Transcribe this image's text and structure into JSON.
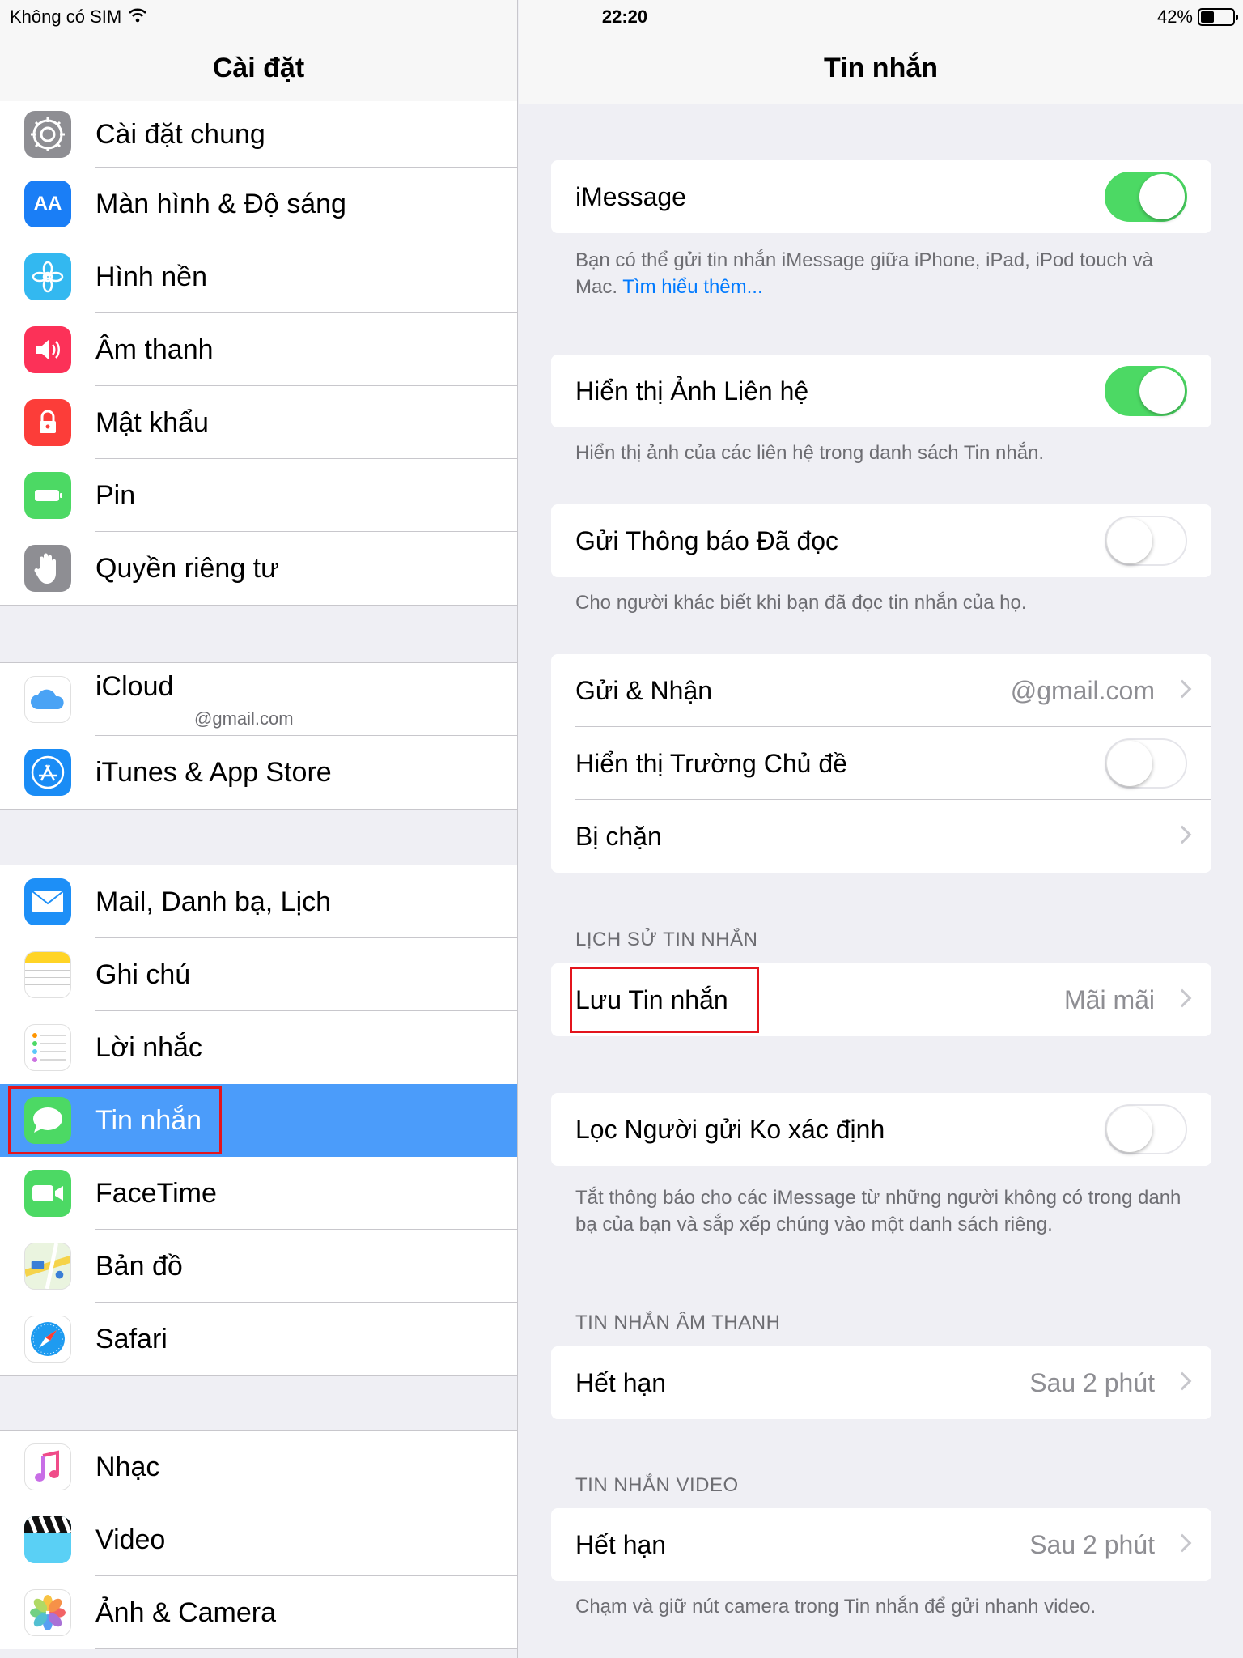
{
  "status_bar": {
    "carrier": "Không có SIM",
    "time": "22:20",
    "battery_text": "42%",
    "battery_level": 0.42
  },
  "master": {
    "title": "Cài đặt",
    "groups": [
      [
        {
          "label": "Cài đặt chung",
          "icon": "gear-icon",
          "color": "#8e8e93"
        },
        {
          "label": "Màn hình & Độ sáng",
          "icon": "display-brightness-icon",
          "color": "#1a7ef6",
          "glyph": "AA"
        },
        {
          "label": "Hình nền",
          "icon": "wallpaper-icon",
          "color": "#33b8f0"
        },
        {
          "label": "Âm thanh",
          "icon": "sound-icon",
          "color": "#fc3158"
        },
        {
          "label": "Mật khẩu",
          "icon": "lock-icon",
          "color": "#fc3d39"
        },
        {
          "label": "Pin",
          "icon": "battery-icon",
          "color": "#4cd964"
        },
        {
          "label": "Quyền riêng tư",
          "icon": "privacy-hand-icon",
          "color": "#8e8e93"
        }
      ],
      [
        {
          "label": "iCloud",
          "sub": "@gmail.com",
          "icon": "icloud-icon",
          "color": "#ffffff"
        },
        {
          "label": "iTunes & App Store",
          "icon": "app-store-icon",
          "color": "#1a8cf5"
        }
      ],
      [
        {
          "label": "Mail, Danh bạ, Lịch",
          "icon": "mail-icon",
          "color": "#1d8ff7"
        },
        {
          "label": "Ghi chú",
          "icon": "notes-icon",
          "color": "#ffffff"
        },
        {
          "label": "Lời nhắc",
          "icon": "reminders-icon",
          "color": "#ffffff"
        },
        {
          "label": "Tin nhắn",
          "icon": "messages-icon",
          "color": "#4cd964",
          "selected": true
        },
        {
          "label": "FaceTime",
          "icon": "facetime-icon",
          "color": "#4cd964"
        },
        {
          "label": "Bản đồ",
          "icon": "maps-icon",
          "color": "#ffffff"
        },
        {
          "label": "Safari",
          "icon": "safari-icon",
          "color": "#ffffff"
        }
      ],
      [
        {
          "label": "Nhạc",
          "icon": "music-icon",
          "color": "#ffffff"
        },
        {
          "label": "Video",
          "icon": "video-icon",
          "color": "#3ec6f0"
        },
        {
          "label": "Ảnh & Camera",
          "icon": "photos-icon",
          "color": "#ffffff"
        }
      ]
    ]
  },
  "detail": {
    "title": "Tin nhắn",
    "imessage": {
      "label": "iMessage",
      "on": true,
      "footer": "Bạn có thể gửi tin nhắn iMessage giữa iPhone, iPad, iPod touch và Mac.",
      "footer_link": "Tìm hiểu thêm..."
    },
    "contact_photos": {
      "label": "Hiển thị Ảnh Liên hệ",
      "on": true,
      "footer": "Hiển thị ảnh của các liên hệ trong danh sách Tin nhắn."
    },
    "read_receipts": {
      "label": "Gửi Thông báo Đã đọc",
      "on": false,
      "footer": "Cho người khác biết khi bạn đã đọc tin nhắn của họ."
    },
    "send_receive": {
      "label": "Gửi & Nhận",
      "value": "@gmail.com"
    },
    "subject_field": {
      "label": "Hiển thị Trường Chủ đề",
      "on": false
    },
    "blocked": {
      "label": "Bị chặn"
    },
    "history_header": "LỊCH SỬ TIN NHẮN",
    "keep_messages": {
      "label": "Lưu Tin nhắn",
      "value": "Mãi mãi"
    },
    "filter_unknown": {
      "label": "Lọc Người gửi Ko xác định",
      "on": false,
      "footer": "Tắt thông báo cho các iMessage từ những người không có trong danh bạ của bạn và sắp xếp chúng vào một danh sách riêng."
    },
    "audio_header": "TIN NHẮN ÂM THANH",
    "audio_expire": {
      "label": "Hết hạn",
      "value": "Sau 2 phút"
    },
    "video_header": "TIN NHẮN VIDEO",
    "video_expire": {
      "label": "Hết hạn",
      "value": "Sau 2 phút",
      "footer": "Chạm và giữ nút camera trong Tin nhắn để gửi nhanh video."
    }
  }
}
